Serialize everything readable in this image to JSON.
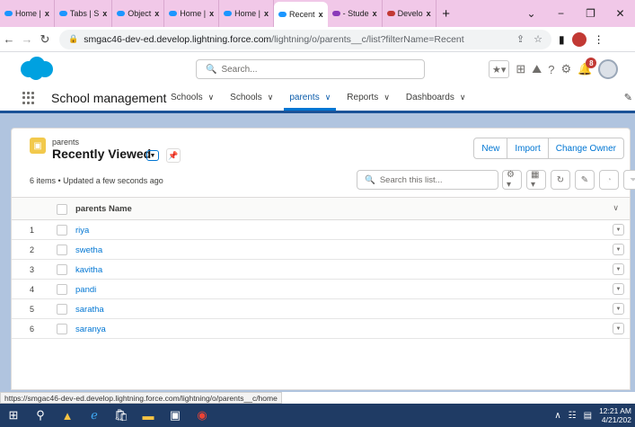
{
  "browser": {
    "tabs": [
      {
        "label": "Home |",
        "active": false,
        "icon": "cloud"
      },
      {
        "label": "Tabs | S",
        "active": false,
        "icon": "cloud"
      },
      {
        "label": "Object",
        "active": false,
        "icon": "cloud"
      },
      {
        "label": "Home |",
        "active": false,
        "icon": "cloud"
      },
      {
        "label": "Home |",
        "active": false,
        "icon": "cloud"
      },
      {
        "label": "Recent",
        "active": true,
        "icon": "cloud"
      },
      {
        "label": "- Stude",
        "active": false,
        "icon": "doc"
      },
      {
        "label": "Develo",
        "active": false,
        "icon": "bolt"
      }
    ],
    "tab_close": "x",
    "new_tab": "+",
    "url_host": "smgac46-dev-ed.develop.lightning.force.com",
    "url_path": "/lightning/o/parents__c/list?filterName=Recent"
  },
  "sf_header": {
    "search_placeholder": "Search...",
    "notification_count": "8"
  },
  "app_nav": {
    "app_name": "School management",
    "items": [
      {
        "label": "Schools",
        "active": false
      },
      {
        "label": "Schools",
        "active": false
      },
      {
        "label": "parents",
        "active": true
      },
      {
        "label": "Reports",
        "active": false
      },
      {
        "label": "Dashboards",
        "active": false
      }
    ]
  },
  "list_view": {
    "object_label": "parents",
    "view_name": "Recently Viewed",
    "summary": "6 items • Updated a few seconds ago",
    "buttons": {
      "new": "New",
      "import": "Import",
      "change_owner": "Change Owner"
    },
    "search_placeholder": "Search this list...",
    "column_header": "parents Name",
    "rows": [
      {
        "num": "1",
        "name": "riya"
      },
      {
        "num": "2",
        "name": "swetha"
      },
      {
        "num": "3",
        "name": "kavitha"
      },
      {
        "num": "4",
        "name": "pandi"
      },
      {
        "num": "5",
        "name": "saratha"
      },
      {
        "num": "6",
        "name": "saranya"
      }
    ]
  },
  "status_link": "https://smgac46-dev-ed.develop.lightning.force.com/lightning/o/parents__c/home",
  "taskbar": {
    "time": "12:21 AM",
    "date": "4/21/202"
  },
  "colors": {
    "brand_blue": "#0176d3",
    "nav_border": "#1b5297",
    "content_bg": "#b0c4df",
    "tabstrip_bg": "#f1c8e8",
    "taskbar_bg": "#1f3b64",
    "object_icon": "#f2c94c"
  }
}
